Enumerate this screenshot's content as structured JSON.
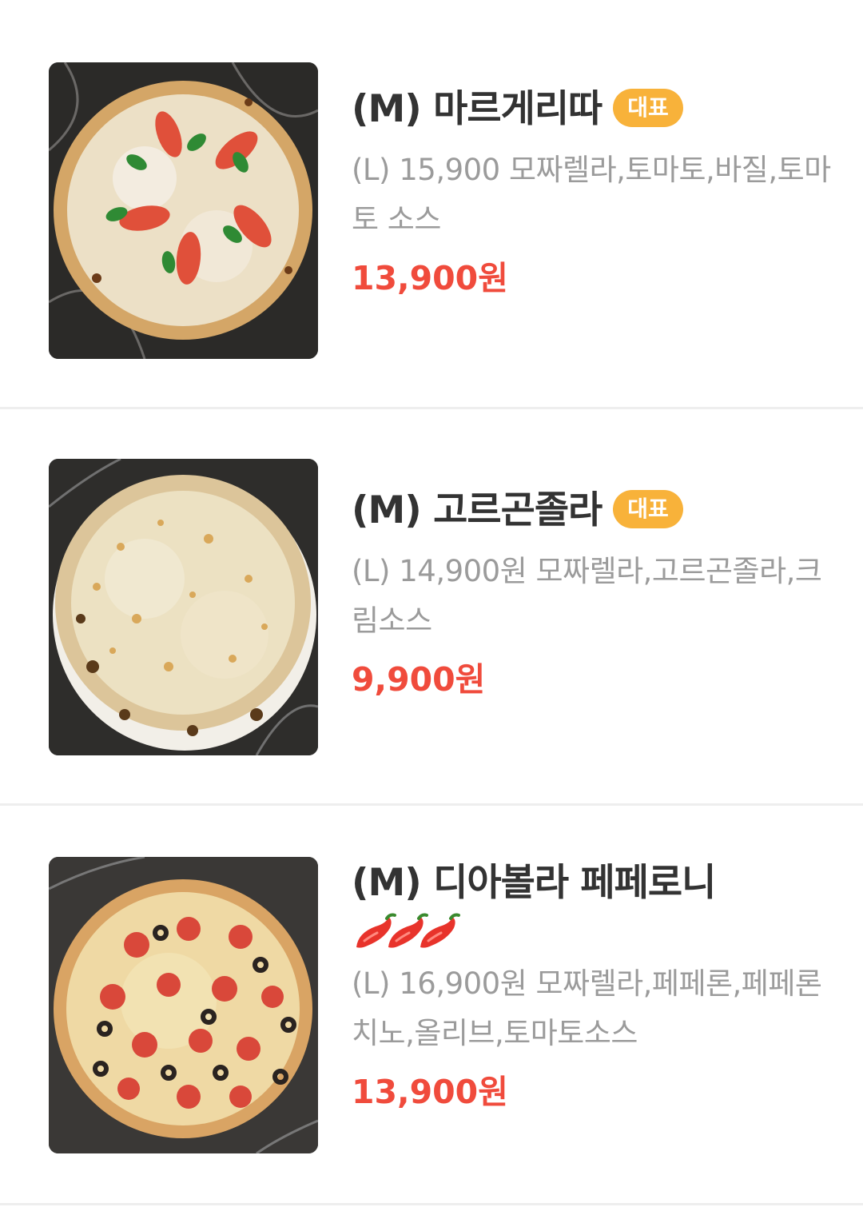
{
  "colors": {
    "badge_bg": "#f8b23a",
    "price": "#f04b3c",
    "name": "#333333",
    "desc": "#9b9b9b",
    "divider": "#eeeeee"
  },
  "menu_items": [
    {
      "name": "(M) 마르게리따",
      "badge": "대표",
      "description": "(L) 15,900 모짜렐라,토마토,바질,토마토 소스",
      "price": "13,900원",
      "image_icon": "margherita-pizza-image"
    },
    {
      "name": "(M) 고르곤졸라",
      "badge": "대표",
      "description": "(L) 14,900원 모짜렐라,고르곤졸라,크림소스",
      "price": "9,900원",
      "image_icon": "gorgonzola-pizza-image"
    },
    {
      "name": "(M) 디아볼라 페페로니",
      "spicy_level": 3,
      "description": "(L) 16,900원 모짜렐라,페페론,페페론치노,올리브,토마토소스",
      "price": "13,900원",
      "image_icon": "diavola-pepperoni-pizza-image"
    }
  ]
}
